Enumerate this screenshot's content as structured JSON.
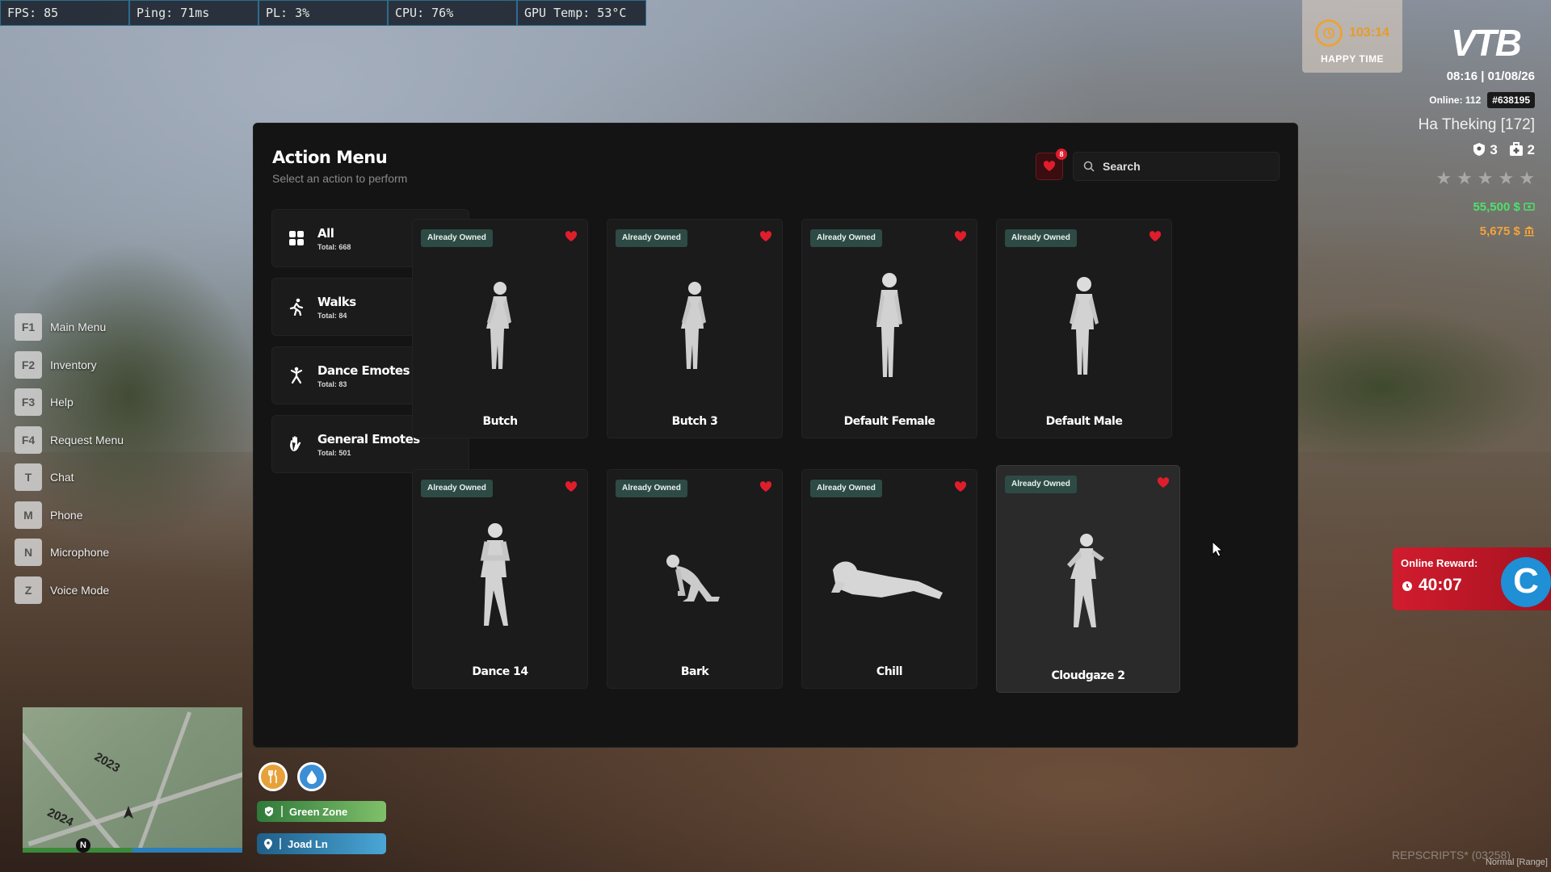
{
  "perf": [
    {
      "label": "FPS: 85"
    },
    {
      "label": "Ping: 71ms"
    },
    {
      "label": "PL: 3%"
    },
    {
      "label": "CPU: 76%"
    },
    {
      "label": "GPU Temp: 53°C"
    }
  ],
  "keyhints": [
    {
      "key": "F1",
      "label": "Main Menu"
    },
    {
      "key": "F2",
      "label": "Inventory"
    },
    {
      "key": "F3",
      "label": "Help"
    },
    {
      "key": "F4",
      "label": "Request Menu"
    },
    {
      "key": "T",
      "label": "Chat"
    },
    {
      "key": "M",
      "label": "Phone"
    },
    {
      "key": "N",
      "label": "Microphone"
    },
    {
      "key": "Z",
      "label": "Voice Mode"
    }
  ],
  "hud": {
    "happy_time": "103:14",
    "happy_label": "HAPPY TIME",
    "brand": "VTB",
    "datetime": "08:16 | 01/08/26",
    "online": "Online: 112",
    "player_id": "#638195",
    "player_name": "Ha Theking [172]",
    "count_a": "3",
    "count_b": "2",
    "money_cash": "55,500 $",
    "money_bank": "5,675 $",
    "stars": [
      "★",
      "★",
      "★",
      "★",
      "★"
    ]
  },
  "reward": {
    "title": "Online Reward:",
    "time": "40:07",
    "logo": "C"
  },
  "minimap": {
    "road_a": "2023",
    "road_b": "2024",
    "north": "N"
  },
  "zones": {
    "green": "Green Zone",
    "street": "Joad Ln"
  },
  "watermark": "REPSCRIPTS* (03258)",
  "watermark2": "Normal [Range]",
  "menu": {
    "title": "Action Menu",
    "subtitle": "Select an action to perform",
    "favorites_count": "8",
    "search_placeholder": "Search",
    "categories": [
      {
        "name": "All",
        "total": "Total: 668",
        "icon": "grid-icon"
      },
      {
        "name": "Walks",
        "total": "Total: 84",
        "icon": "walking-icon"
      },
      {
        "name": "Dance Emotes",
        "total": "Total: 83",
        "icon": "dance-icon"
      },
      {
        "name": "General Emotes",
        "total": "Total: 501",
        "icon": "hand-wave-icon"
      }
    ],
    "cards": [
      {
        "name": "Butch",
        "badge": "Already Owned",
        "pose": "walk"
      },
      {
        "name": "Butch 3",
        "badge": "Already Owned",
        "pose": "walk"
      },
      {
        "name": "Default Female",
        "badge": "Already Owned",
        "pose": "stand"
      },
      {
        "name": "Default Male",
        "badge": "Already Owned",
        "pose": "stand"
      },
      {
        "name": "Dance 14",
        "badge": "Already Owned",
        "pose": "dance"
      },
      {
        "name": "Bark",
        "badge": "Already Owned",
        "pose": "kneel"
      },
      {
        "name": "Chill",
        "badge": "Already Owned",
        "pose": "lie"
      },
      {
        "name": "Cloudgaze 2",
        "badge": "Already Owned",
        "pose": "run"
      }
    ]
  }
}
